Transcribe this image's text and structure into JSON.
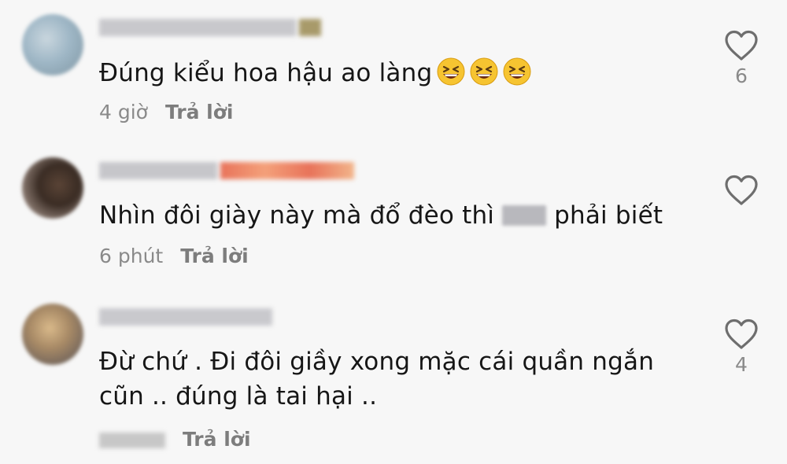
{
  "comments": [
    {
      "text": "Đúng kiểu hoa hậu ao làng",
      "emojis": [
        "grinning-squinting-face",
        "grinning-squinting-face",
        "grinning-squinting-face"
      ],
      "time": "4 giờ",
      "reply_label": "Trả lời",
      "likes": "6"
    },
    {
      "text_before": "Nhìn đôi giày này mà đổ đèo thì",
      "text_after": "phải biết",
      "time": "6 phút",
      "reply_label": "Trả lời",
      "likes": ""
    },
    {
      "text_line1": "Đừ chứ . Đi đôi giầy xong mặc cái quần ngắn",
      "text_line2": "cũn .. đúng là tai hại ..",
      "reply_label": "Trả lời",
      "likes": "4"
    }
  ],
  "colors": {
    "background": "#f7f7f7",
    "text": "#161616",
    "meta": "#8a8a8a",
    "heart_outline": "#6e6e6e"
  },
  "icons": {
    "like": "heart-outline-icon",
    "emoji": "grinning-squinting-face"
  }
}
